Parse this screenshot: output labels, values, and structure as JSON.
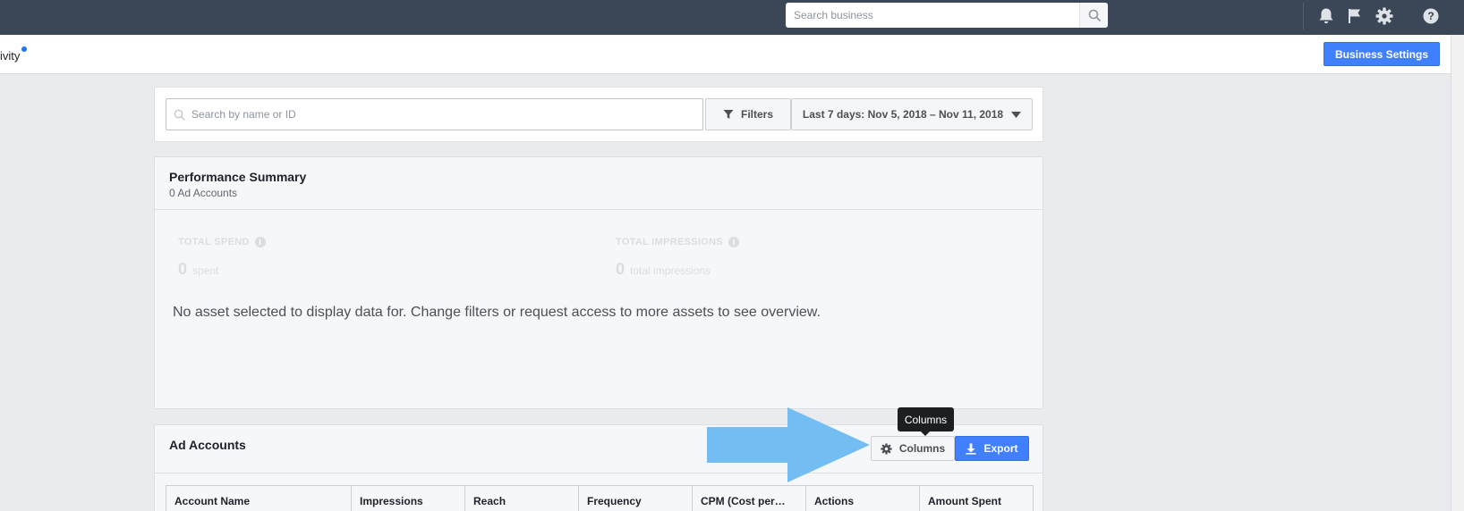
{
  "topbar": {
    "search_placeholder": "Search business",
    "icons": [
      "search-icon",
      "bell-icon",
      "flag-icon",
      "gear-icon",
      "help-icon"
    ]
  },
  "subheader": {
    "activity_label": "ivity",
    "business_settings_label": "Business Settings"
  },
  "filters": {
    "search_placeholder": "Search by name or ID",
    "filters_label": "Filters",
    "date_range_label": "Last 7 days: Nov 5, 2018 – Nov 11, 2018"
  },
  "performance": {
    "title": "Performance Summary",
    "subtitle": "0 Ad Accounts",
    "metrics": [
      {
        "label": "TOTAL SPEND",
        "value": "0",
        "unit": "spent"
      },
      {
        "label": "TOTAL IMPRESSIONS",
        "value": "0",
        "unit": "total impressions"
      }
    ],
    "empty_message": "No asset selected to display data for. Change filters or request access to more assets to see overview."
  },
  "ad_accounts": {
    "title": "Ad Accounts",
    "columns_label": "Columns",
    "export_label": "Export",
    "table_headers": [
      "Account Name",
      "Impressions",
      "Reach",
      "Frequency",
      "CPM (Cost per…",
      "Actions",
      "Amount Spent"
    ]
  },
  "tooltip": {
    "text": "Columns"
  },
  "colors": {
    "topbar": "#3b4656",
    "primary_button": "#4080ff",
    "annotation_arrow": "#74bdf2",
    "page_background": "#e9ebee"
  }
}
